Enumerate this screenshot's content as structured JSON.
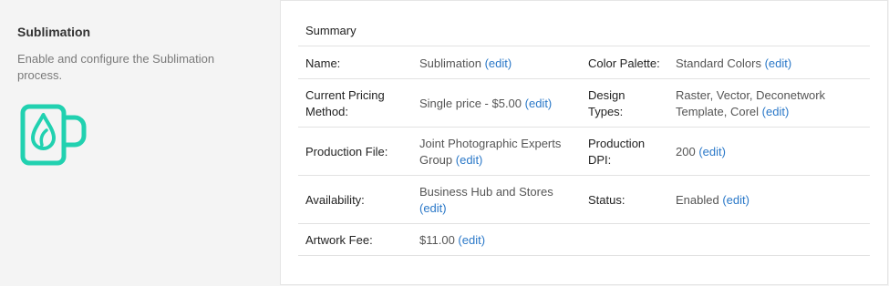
{
  "section": {
    "title": "Sublimation",
    "description": "Enable and configure the Sublimation process.",
    "icon": "sublimation-mug-icon",
    "icon_color": "#21d1b0"
  },
  "summary": {
    "header": "Summary",
    "edit_label": "(edit)",
    "link_color": "#2a78c8",
    "name_label": "Name:",
    "name_value": "Sublimation",
    "color_palette_label": "Color Palette:",
    "color_palette_value": "Standard Colors",
    "pricing_label": "Current Pricing Method:",
    "pricing_value": "Single price - $5.00",
    "design_types_label": "Design Types:",
    "design_types_value": "Raster, Vector, Deconetwork Template, Corel",
    "production_file_label": "Production File:",
    "production_file_value": "Joint Photographic Experts Group",
    "production_dpi_label": "Production DPI:",
    "production_dpi_value": "200",
    "availability_label": "Availability:",
    "availability_value": "Business Hub and Stores",
    "status_label": "Status:",
    "status_value": "Enabled",
    "artwork_fee_label": "Artwork Fee:",
    "artwork_fee_value": "$11.00"
  }
}
